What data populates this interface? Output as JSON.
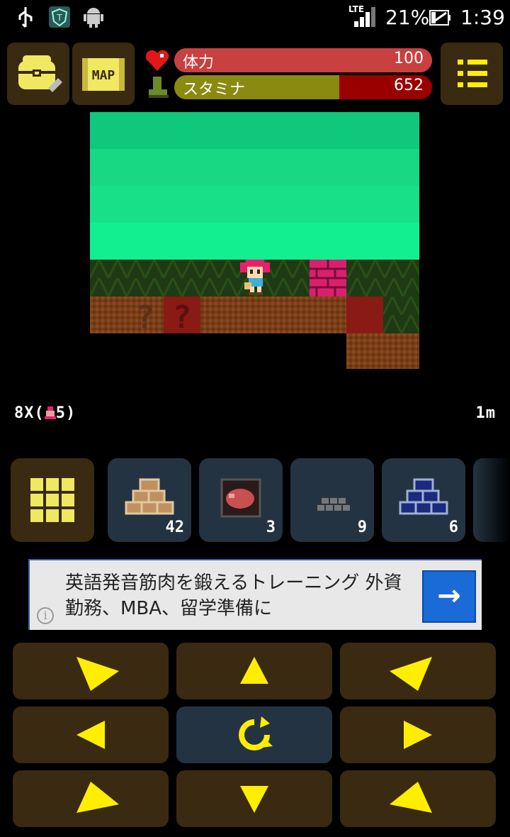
{
  "status_bar": {
    "network": "LTE",
    "battery": "21%",
    "time": "1:39"
  },
  "hud": {
    "hp_label": "体力",
    "hp_value": "100",
    "hp_fraction": 1.0,
    "stamina_label": "スタミナ",
    "stamina_value": "652",
    "stamina_fraction": 0.64,
    "map_label": "MAP"
  },
  "position": {
    "left_text": "8X(",
    "left_text_end": "5)",
    "depth": "1m"
  },
  "inventory": [
    {
      "name": "brown-blocks",
      "count": "42"
    },
    {
      "name": "meat",
      "count": "3"
    },
    {
      "name": "gray-bricks",
      "count": "9"
    },
    {
      "name": "blue-blocks",
      "count": "6"
    }
  ],
  "ad": {
    "text": "英語発音筋肉を鍛えるトレーニング 外資勤務、MBA、留学準備に",
    "info_icon": "i",
    "arrow_icon": "→"
  },
  "colors": {
    "hud_button": "#3a2a12",
    "inventory_slot": "#243342",
    "arrow": "#ffee00",
    "hp_bar": "#c84040",
    "stamina_bar": "#8a8a10"
  }
}
